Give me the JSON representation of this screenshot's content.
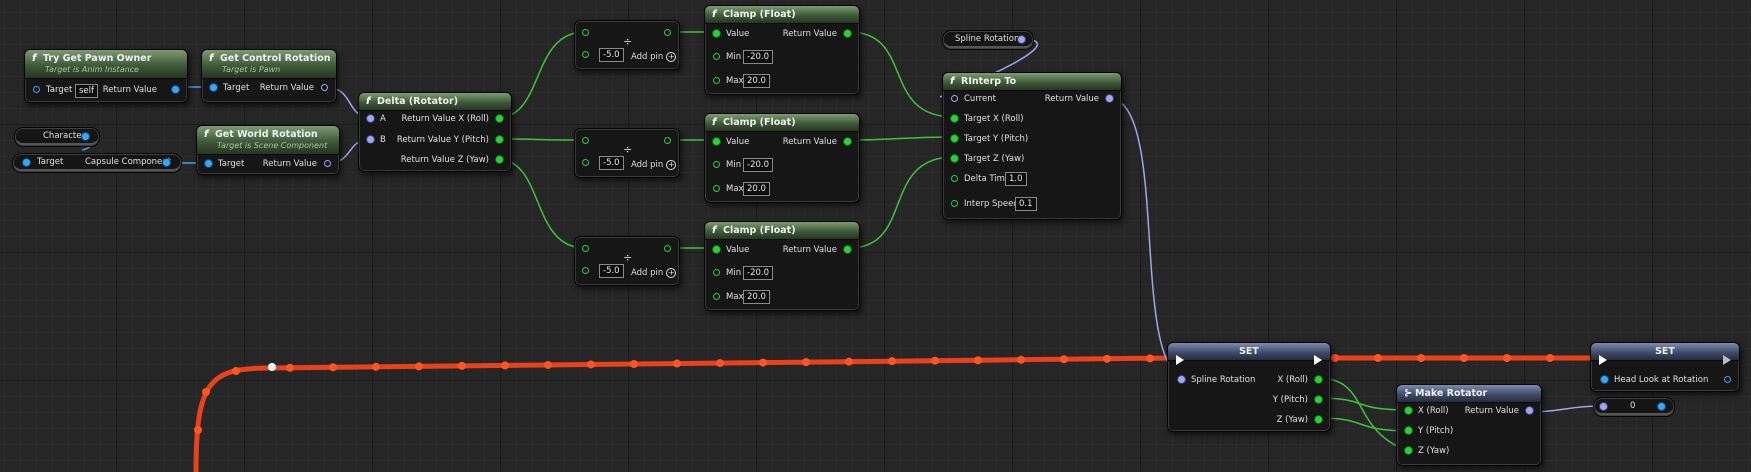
{
  "nodes": {
    "try_get_pawn_owner": {
      "title": "Try Get Pawn Owner",
      "subtitle": "Target is Anim Instance",
      "target_label": "Target",
      "target_value": "self",
      "return_label": "Return Value"
    },
    "get_control_rotation": {
      "title": "Get Control Rotation",
      "subtitle": "Target is Pawn",
      "target_label": "Target",
      "return_label": "Return Value"
    },
    "get_world_rotation": {
      "title": "Get World Rotation",
      "subtitle": "Target is Scene Component",
      "target_label": "Target",
      "return_label": "Return Value"
    },
    "character_var": {
      "label": "Character"
    },
    "capsule_component": {
      "target_label": "Target",
      "label": "Capsule Component"
    },
    "delta_rotator": {
      "title": "Delta (Rotator)",
      "a_label": "A",
      "b_label": "B",
      "ret_x": "Return Value X (Roll)",
      "ret_y": "Return Value Y (Pitch)",
      "ret_z": "Return Value Z (Yaw)"
    },
    "divide_nodes": [
      {
        "symbol": "÷",
        "value": "-5.0",
        "add_pin": "Add pin"
      },
      {
        "symbol": "÷",
        "value": "-5.0",
        "add_pin": "Add pin"
      },
      {
        "symbol": "÷",
        "value": "-5.0",
        "add_pin": "Add pin"
      }
    ],
    "clamp_nodes": [
      {
        "title": "Clamp (Float)",
        "value_label": "Value",
        "return_label": "Return Value",
        "min_label": "Min",
        "min_value": "-20.0",
        "max_label": "Max",
        "max_value": "20.0"
      },
      {
        "title": "Clamp (Float)",
        "value_label": "Value",
        "return_label": "Return Value",
        "min_label": "Min",
        "min_value": "-20.0",
        "max_label": "Max",
        "max_value": "20.0"
      },
      {
        "title": "Clamp (Float)",
        "value_label": "Value",
        "return_label": "Return Value",
        "min_label": "Min",
        "min_value": "-20.0",
        "max_label": "Max",
        "max_value": "20.0"
      }
    ],
    "spline_rotation_var": {
      "label": "Spline Rotation"
    },
    "rinterp_to": {
      "title": "RInterp To",
      "current_label": "Current",
      "return_label": "Return Value",
      "target_x": "Target X (Roll)",
      "target_y": "Target Y (Pitch)",
      "target_z": "Target Z (Yaw)",
      "delta_time_label": "Delta Time",
      "delta_time_value": "1.0",
      "interp_speed_label": "Interp Speed",
      "interp_speed_value": "0.1"
    },
    "set_spline": {
      "title": "SET",
      "pin_label": "Spline Rotation",
      "x": "X (Roll)",
      "y": "Y (Pitch)",
      "z": "Z (Yaw)"
    },
    "make_rotator": {
      "title": "Make Rotator",
      "x": "X (Roll)",
      "y": "Y (Pitch)",
      "z": "Z (Yaw)",
      "return_label": "Return Value"
    },
    "set_head_look": {
      "title": "SET",
      "pin_label": "Head Look at Rotation"
    },
    "reroute_var": {
      "label": "0"
    }
  },
  "colors": {
    "exec_wire": "#e8421c",
    "float_wire": "#3ec43a",
    "rotator_wire": "#9da7ee",
    "object_wire": "#3aa4f5",
    "function_header": "#4f6a47",
    "make_header": "#4a5778"
  },
  "icons": [
    "function-icon",
    "make-struct-icon",
    "exec-pin-icon",
    "add-pin-icon"
  ]
}
